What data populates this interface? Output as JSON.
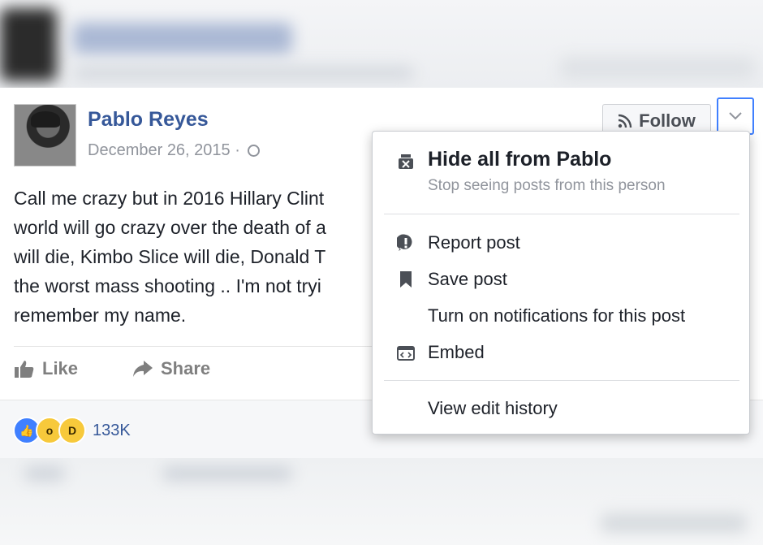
{
  "post": {
    "author": "Pablo Reyes",
    "date": "December 26, 2015",
    "text": "Call me crazy but in 2016 Hillary Clint\nworld will go crazy over the death of a\nwill die, Kimbo Slice will die, Donald T\nthe worst mass shooting .. I'm not tryi\nremember my name.",
    "follow_label": "Follow",
    "actions": {
      "like": "Like",
      "share": "Share"
    },
    "reaction_count": "133K"
  },
  "menu": {
    "hide_title": "Hide all from Pablo",
    "hide_subtitle": "Stop seeing posts from this person",
    "items": [
      {
        "label": "Report post",
        "icon": "alert-icon"
      },
      {
        "label": "Save post",
        "icon": "bookmark-icon"
      },
      {
        "label": "Turn on notifications for this post",
        "icon": ""
      },
      {
        "label": "Embed",
        "icon": "embed-code-icon"
      },
      {
        "label": "View edit history",
        "icon": ""
      }
    ]
  },
  "colors": {
    "name_blue": "#365899",
    "accent": "#4080ff",
    "muted": "#90949c"
  }
}
